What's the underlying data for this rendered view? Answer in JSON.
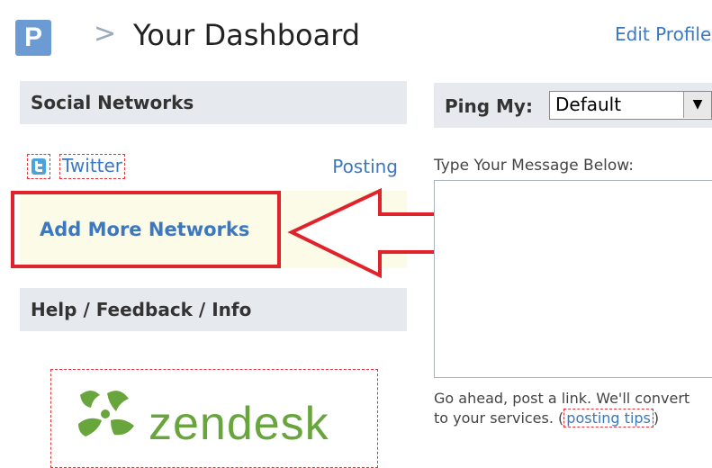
{
  "header": {
    "logo_letter": "P",
    "separator": ">",
    "title": "Your Dashboard",
    "edit_profile": "Edit Profile"
  },
  "social": {
    "heading": "Social Networks",
    "twitter_label": "Twitter",
    "posting_label": "Posting",
    "add_more": "Add More Networks"
  },
  "help": {
    "heading": "Help / Feedback / Info",
    "zendesk_word": "zendesk"
  },
  "ping": {
    "label": "Ping My:",
    "selected": "Default",
    "dropdown_icon": "▼"
  },
  "message": {
    "label": "Type Your Message Below:",
    "value": "",
    "help_line1": "Go ahead, post a link. We'll convert",
    "help_line2_prefix": "to your services. (",
    "tips_link": "posting tips",
    "help_line2_suffix": ")"
  },
  "colors": {
    "accent_red": "#e0232b",
    "link_blue": "#3b78c0",
    "panel_gray": "#e6e9ee",
    "zendesk_green": "#69a53d"
  }
}
